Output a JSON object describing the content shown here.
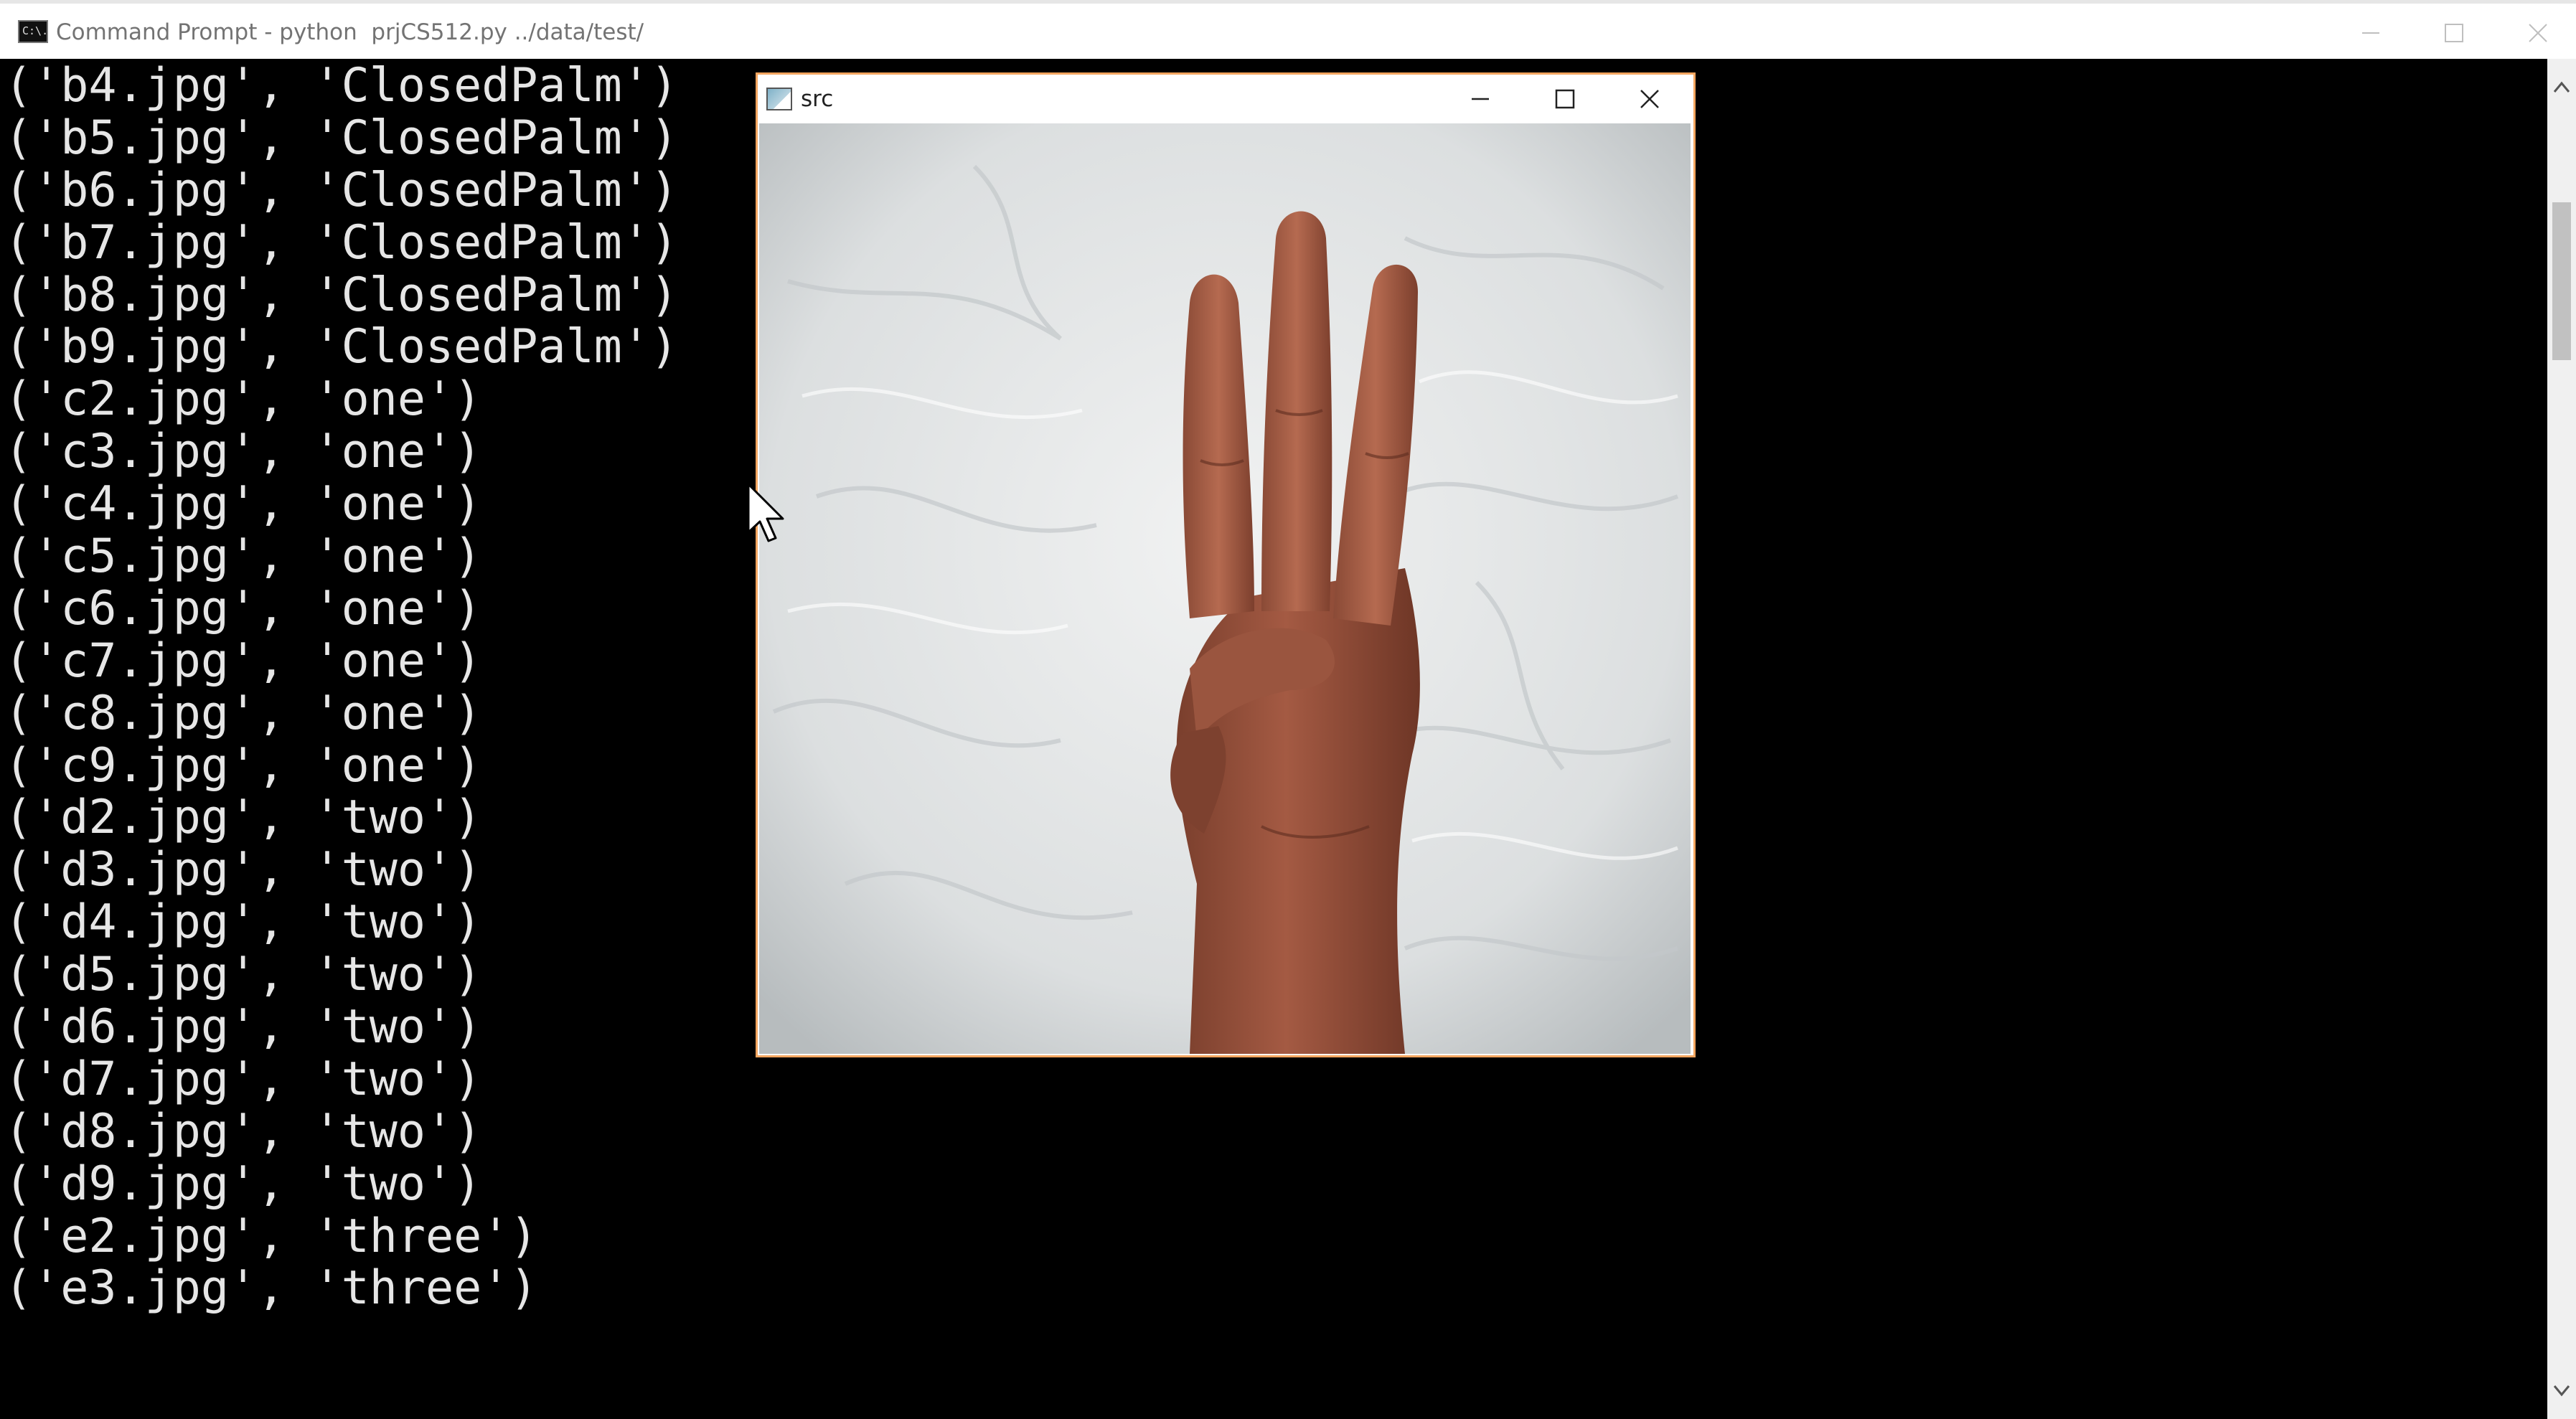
{
  "console": {
    "title": "Command Prompt - python  prjCS512.py ../data/test/",
    "icon_text": "C:\\.",
    "lines": [
      "('b4.jpg', 'ClosedPalm')",
      "('b5.jpg', 'ClosedPalm')",
      "('b6.jpg', 'ClosedPalm')",
      "('b7.jpg', 'ClosedPalm')",
      "('b8.jpg', 'ClosedPalm')",
      "('b9.jpg', 'ClosedPalm')",
      "('c2.jpg', 'one')",
      "('c3.jpg', 'one')",
      "('c4.jpg', 'one')",
      "('c5.jpg', 'one')",
      "('c6.jpg', 'one')",
      "('c7.jpg', 'one')",
      "('c8.jpg', 'one')",
      "('c9.jpg', 'one')",
      "('d2.jpg', 'two')",
      "('d3.jpg', 'two')",
      "('d4.jpg', 'two')",
      "('d5.jpg', 'two')",
      "('d6.jpg', 'two')",
      "('d7.jpg', 'two')",
      "('d8.jpg', 'two')",
      "('d9.jpg', 'two')",
      "('e2.jpg', 'three')",
      "('e3.jpg', 'three')"
    ],
    "text_color": "#e6e6e6",
    "background_color": "#000000"
  },
  "image_window": {
    "title": "src",
    "border_color": "#f3a55f",
    "content": "hand-three-fingers-photo"
  },
  "icons": {
    "console_app": "command-prompt-icon",
    "minimize": "minimize-icon",
    "maximize": "maximize-icon",
    "close": "close-icon",
    "image_window_app": "image-window-icon",
    "cursor": "mouse-cursor-icon"
  }
}
